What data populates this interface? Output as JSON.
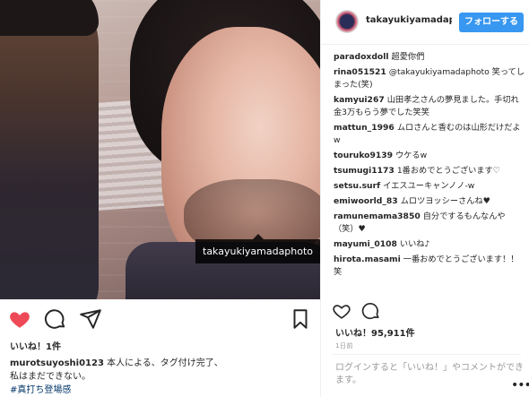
{
  "postA": {
    "tag_label": "takayukiyamadaphoto",
    "likes": "いいね！1件",
    "caption": {
      "user": "murotsuyoshi0123",
      "text_line1": " 本人による、タグ付け完了、",
      "text_line2": "私はまだできない。",
      "hashtag": "#真打ち登場感"
    },
    "icons": [
      "heart-filled-icon",
      "comment-icon",
      "share-icon",
      "bookmark-icon"
    ],
    "accent_red": "#ed4956"
  },
  "postB": {
    "username": "takayukiyamadapl",
    "follow_label": "フォローする",
    "follow_color": "#3897f0",
    "comments": [
      {
        "user": "paradoxdoll",
        "text": "超愛你們"
      },
      {
        "user": "rina051521",
        "text": "@takayukiyamadaphoto 笑ってしまった(笑)"
      },
      {
        "user": "kamyui267",
        "text": "山田孝之さんの夢見ました。手切れ金3万もらう夢でした笑笑"
      },
      {
        "user": "mattun_1996",
        "text": "ムロさんと香むのは山形だけだよw"
      },
      {
        "user": "touruko9139",
        "text": "ウケるw"
      },
      {
        "user": "tsumugi1173",
        "text": "1番おめでとうございます♡"
      },
      {
        "user": "setsu.surf",
        "text": "イエスユーキャンノノ-w"
      },
      {
        "user": "emiwoorld_83",
        "text": "ムロツヨッシーさんね♥"
      },
      {
        "user": "ramunemama3850",
        "text": "自分でするもんなんや（笑）♥"
      },
      {
        "user": "mayumi_0108",
        "text": "いいね♪"
      },
      {
        "user": "hirota.masami",
        "text": "一番おめでとうございます！！笑"
      }
    ],
    "likes": "いいね！95,911件",
    "time": "1日前",
    "login_prompt_prefix": "ログイン",
    "login_prompt_text": "すると「いいね！」やコメントができます。",
    "more": "•••",
    "icons": [
      "heart-outline-icon",
      "comment-icon"
    ]
  }
}
